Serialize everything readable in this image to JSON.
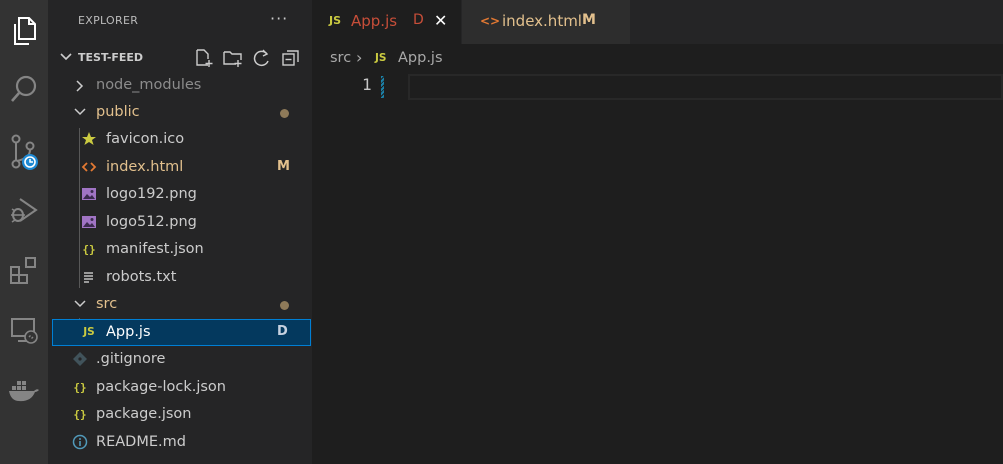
{
  "activity_bar": {
    "items": [
      "files-icon",
      "search-icon",
      "source-control-icon",
      "run-debug-icon",
      "extensions-icon",
      "remote-explorer-icon",
      "docker-icon"
    ]
  },
  "explorer": {
    "title": "EXPLORER",
    "more": "···",
    "folder": "TEST-FEED",
    "items": [
      {
        "label": "node_modules",
        "type": "folder-collapsed"
      },
      {
        "label": "public",
        "type": "folder-open",
        "status": "dot"
      },
      {
        "label": "favicon.ico",
        "icon": "star-icon"
      },
      {
        "label": "index.html",
        "icon": "html-icon",
        "badge": "M"
      },
      {
        "label": "logo192.png",
        "icon": "image-icon"
      },
      {
        "label": "logo512.png",
        "icon": "image-icon"
      },
      {
        "label": "manifest.json",
        "icon": "json-icon"
      },
      {
        "label": "robots.txt",
        "icon": "text-file-icon"
      },
      {
        "label": "src",
        "type": "folder-open",
        "status": "dot"
      },
      {
        "label": "App.js",
        "icon": "js-icon",
        "badge": "D",
        "selected": true
      },
      {
        "label": ".gitignore",
        "icon": "git-icon"
      },
      {
        "label": "package-lock.json",
        "icon": "json-icon"
      },
      {
        "label": "package.json",
        "icon": "json-icon"
      },
      {
        "label": "README.md",
        "icon": "info-icon"
      }
    ]
  },
  "tabs": [
    {
      "icon_text": "JS",
      "label": "App.js",
      "badge": "D",
      "close": "✕",
      "active": true
    },
    {
      "icon_text": "<>",
      "label": "index.html",
      "badge": "M",
      "active": false
    }
  ],
  "breadcrumbs": {
    "folder": "src",
    "separator": "›",
    "icon_text": "JS",
    "file": "App.js"
  },
  "editor": {
    "line_numbers": [
      "1"
    ]
  },
  "colors": {
    "deleted": "#c74e39",
    "modified": "#e2c08d",
    "js": "#cbcb41",
    "html": "#e37933",
    "selection": "#04395e",
    "focus_border": "#007fd4"
  }
}
